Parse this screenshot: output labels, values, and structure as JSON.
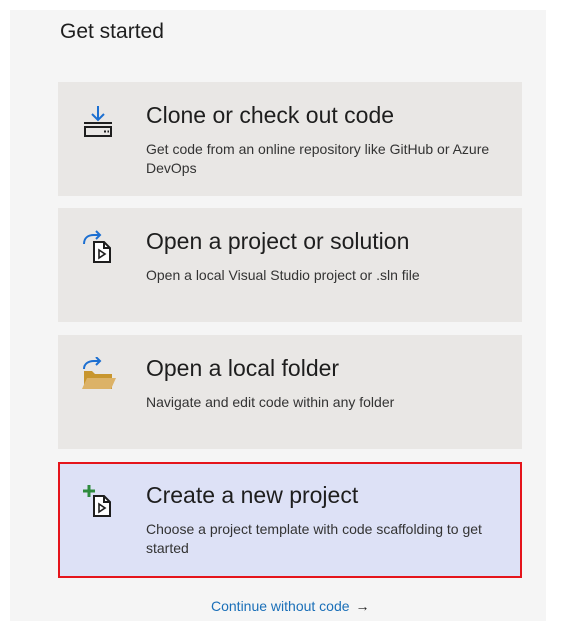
{
  "heading": "Get started",
  "cards": [
    {
      "title": "Clone or check out code",
      "description": "Get code from an online repository like GitHub or Azure DevOps",
      "icon": "clone-download-icon"
    },
    {
      "title": "Open a project or solution",
      "description": "Open a local Visual Studio project or .sln file",
      "icon": "open-project-icon"
    },
    {
      "title": "Open a local folder",
      "description": "Navigate and edit code within any folder",
      "icon": "open-folder-icon"
    },
    {
      "title": "Create a new project",
      "description": "Choose a project template with code scaffolding to get started",
      "icon": "new-project-icon"
    }
  ],
  "continue_link": "Continue without code",
  "continue_arrow": "→",
  "colors": {
    "card_bg": "#e9e7e5",
    "selected_bg": "#dde1f6",
    "selected_border": "#e5141b",
    "link": "#1a6fb8",
    "icon_blue": "#1c6fd1",
    "icon_green": "#2e8b3d",
    "folder": "#dcb267"
  }
}
